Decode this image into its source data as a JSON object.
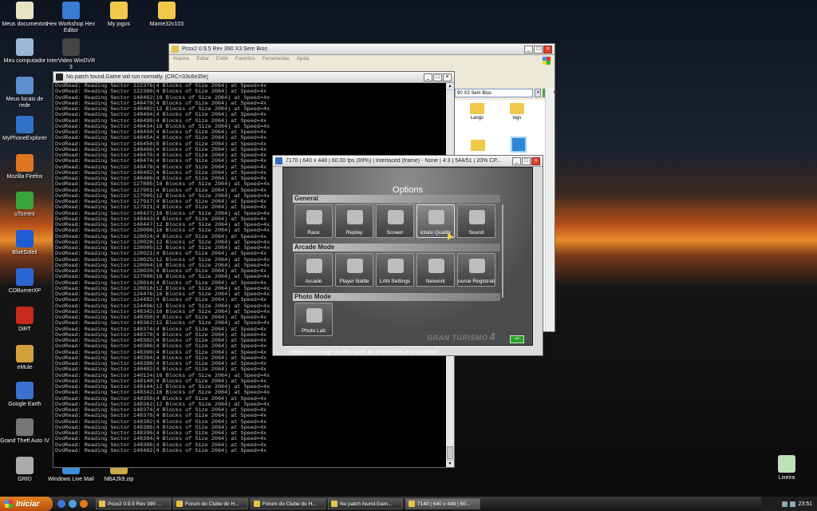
{
  "desktop": {
    "icons": [
      {
        "label": "Meus documentos",
        "color": "#e9e3c2"
      },
      {
        "label": "Hex Workshop Hex Editor",
        "color": "#3a7bd5"
      },
      {
        "label": "My jogos",
        "color": "#f0c94a"
      },
      {
        "label": "Mame32v103",
        "color": "#f0c94a"
      },
      {
        "label": "Meu computador",
        "color": "#9ab7d8"
      },
      {
        "label": "InterVideo WinDVR 3",
        "color": "#444444"
      },
      {
        "label": "Meus locais de rede",
        "color": "#5b8fd0"
      },
      {
        "label": "MyPhoneExplorer",
        "color": "#2f73c9"
      },
      {
        "label": "Mozilla Firefox",
        "color": "#e0751f"
      },
      {
        "label": "uTorrent",
        "color": "#3aa33a"
      },
      {
        "label": "BlueSoleil",
        "color": "#1f5bd4"
      },
      {
        "label": "CDBurnerXP",
        "color": "#2b67d2"
      },
      {
        "label": "DiRT",
        "color": "#c8281e"
      },
      {
        "label": "eMule",
        "color": "#d2a03a"
      },
      {
        "label": "Google Earth",
        "color": "#3b6fd0"
      },
      {
        "label": "Grand Theft Auto IV",
        "color": "#777777"
      },
      {
        "label": "GRID",
        "color": "#aaaaaa"
      },
      {
        "label": "Windows Live Mail",
        "color": "#3d8de0"
      },
      {
        "label": "NBA2k9.zip",
        "color": "#c9a94a"
      },
      {
        "label": "Lixeira",
        "color": "#bfe0b8"
      }
    ]
  },
  "explorer": {
    "title": "Pcsx2 0.9.5 Rev 390 X3 Sem Bios",
    "menu": [
      "Arquivo",
      "Editar",
      "Exibir",
      "Favoritos",
      "Ferramentas",
      "Ajuda"
    ],
    "address": "90 X3 Sem Bios",
    "go_label": "Ir",
    "folders": [
      "Langs",
      "logs"
    ]
  },
  "console": {
    "title": "No patch found.Game will run normally. [CRC=33c6e35e]",
    "lines": [
      "DvdRead: Reading Sector 122376(4 Blocks of Size 2064) at Speed=4x",
      "DvdRead: Reading Sector 122380(4 Blocks of Size 2064) at Speed=4x",
      "DvdRead: Reading Sector 148462(16 Blocks of Size 2064) at Speed=4x",
      "DvdRead: Reading Sector 148478(4 Blocks of Size 2064) at Speed=4x",
      "DvdRead: Reading Sector 148482(12 Blocks of Size 2064) at Speed=4x",
      "DvdRead: Reading Sector 148494(4 Blocks of Size 2064) at Speed=4x",
      "DvdRead: Reading Sector 148498(4 Blocks of Size 2064) at Speed=4x",
      "DvdRead: Reading Sector 148434(16 Blocks of Size 2064) at Speed=4x",
      "DvdRead: Reading Sector 148450(4 Blocks of Size 2064) at Speed=4x",
      "DvdRead: Reading Sector 148454(4 Blocks of Size 2064) at Speed=4x",
      "DvdRead: Reading Sector 148458(8 Blocks of Size 2064) at Speed=4x",
      "DvdRead: Reading Sector 148466(4 Blocks of Size 2064) at Speed=4x",
      "DvdRead: Reading Sector 148470(4 Blocks of Size 2064) at Speed=4x",
      "DvdRead: Reading Sector 148474(4 Blocks of Size 2064) at Speed=4x",
      "DvdRead: Reading Sector 148478(4 Blocks of Size 2064) at Speed=4x",
      "DvdRead: Reading Sector 148482(4 Blocks of Size 2064) at Speed=4x",
      "DvdRead: Reading Sector 148486(4 Blocks of Size 2064) at Speed=4x",
      "DvdRead: Reading Sector 127885(16 Blocks of Size 2064) at Speed=4x",
      "DvdRead: Reading Sector 127901(4 Blocks of Size 2064) at Speed=4x",
      "DvdRead: Reading Sector 127905(12 Blocks of Size 2064) at Speed=4x",
      "DvdRead: Reading Sector 127917(4 Blocks of Size 2064) at Speed=4x",
      "DvdRead: Reading Sector 127921(4 Blocks of Size 2064) at Speed=4x",
      "DvdRead: Reading Sector 148427(16 Blocks of Size 2064) at Speed=4x",
      "DvdRead: Reading Sector 148443(4 Blocks of Size 2064) at Speed=4x",
      "DvdRead: Reading Sector 148447(12 Blocks of Size 2064) at Speed=4x",
      "DvdRead: Reading Sector 128008(16 Blocks of Size 2064) at Speed=4x",
      "DvdRead: Reading Sector 128024(4 Blocks of Size 2064) at Speed=4x",
      "DvdRead: Reading Sector 128028(12 Blocks of Size 2064) at Speed=4x",
      "DvdRead: Reading Sector 128005(12 Blocks of Size 2064) at Speed=4x",
      "DvdRead: Reading Sector 128021(4 Blocks of Size 2064) at Speed=4x",
      "DvdRead: Reading Sector 128025(12 Blocks of Size 2064) at Speed=4x",
      "DvdRead: Reading Sector 128004(16 Blocks of Size 2064) at Speed=4x",
      "DvdRead: Reading Sector 128020(4 Blocks of Size 2064) at Speed=4x",
      "DvdRead: Reading Sector 127998(16 Blocks of Size 2064) at Speed=4x",
      "DvdRead: Reading Sector 128014(4 Blocks of Size 2064) at Speed=4x",
      "DvdRead: Reading Sector 128018(12 Blocks of Size 2064) at Speed=4x",
      "DvdRead: Reading Sector 124476(16 Blocks of Size 2064) at Speed=4x",
      "DvdRead: Reading Sector 124492(4 Blocks of Size 2064) at Speed=4x",
      "DvdRead: Reading Sector 124496(12 Blocks of Size 2064) at Speed=4x",
      "DvdRead: Reading Sector 148342(16 Blocks of Size 2064) at Speed=4x",
      "DvdRead: Reading Sector 148358(4 Blocks of Size 2064) at Speed=4x",
      "DvdRead: Reading Sector 148362(12 Blocks of Size 2064) at Speed=4x",
      "DvdRead: Reading Sector 148374(4 Blocks of Size 2064) at Speed=4x",
      "DvdRead: Reading Sector 148378(4 Blocks of Size 2064) at Speed=4x",
      "DvdRead: Reading Sector 148382(4 Blocks of Size 2064) at Speed=4x",
      "DvdRead: Reading Sector 148386(4 Blocks of Size 2064) at Speed=4x",
      "DvdRead: Reading Sector 148390(4 Blocks of Size 2064) at Speed=4x",
      "DvdRead: Reading Sector 148394(4 Blocks of Size 2064) at Speed=4x",
      "DvdRead: Reading Sector 148398(4 Blocks of Size 2064) at Speed=4x",
      "DvdRead: Reading Sector 148402(4 Blocks of Size 2064) at Speed=4x",
      "DvdRead: Reading Sector 140124(16 Blocks of Size 2064) at Speed=4x",
      "DvdRead: Reading Sector 148140(4 Blocks of Size 2064) at Speed=4x",
      "DvdRead: Reading Sector 148144(12 Blocks of Size 2064) at Speed=4x",
      "DvdRead: Reading Sector 148342(16 Blocks of Size 2064) at Speed=4x",
      "DvdRead: Reading Sector 148358(4 Blocks of Size 2064) at Speed=4x",
      "DvdRead: Reading Sector 148362(12 Blocks of Size 2064) at Speed=4x",
      "DvdRead: Reading Sector 148374(4 Blocks of Size 2064) at Speed=4x",
      "DvdRead: Reading Sector 148378(4 Blocks of Size 2064) at Speed=4x",
      "DvdRead: Reading Sector 148382(4 Blocks of Size 2064) at Speed=4x",
      "DvdRead: Reading Sector 148386(4 Blocks of Size 2064) at Speed=4x",
      "DvdRead: Reading Sector 148390(4 Blocks of Size 2064) at Speed=4x",
      "DvdRead: Reading Sector 148394(4 Blocks of Size 2064) at Speed=4x",
      "DvdRead: Reading Sector 148398(4 Blocks of Size 2064) at Speed=4x",
      "DvdRead: Reading Sector 148402(4 Blocks of Size 2064) at Speed=4x"
    ]
  },
  "game": {
    "title": "7170 | 640 x 448 | 60.00 fps (99%) | Interlaced (frame) - None | 4:3 | 544/51 | 20% CP...",
    "screen_title": "Options",
    "sections": [
      {
        "label": "General",
        "tiles": [
          "Race",
          "Replay",
          "Screen",
          "icture Quality",
          "Sound"
        ]
      },
      {
        "label": "Arcade Mode",
        "tiles": [
          "Arcade",
          "Player Battle",
          "LAN Settings",
          "Network",
          "ourse Registration"
        ]
      },
      {
        "label": "Photo Mode",
        "tiles": [
          "Photo Lab"
        ]
      }
    ],
    "logo_text": "GRAN TURISMO",
    "logo_number": "4",
    "help_text": "related to image quality such as brightness and contrast"
  },
  "taskbar": {
    "start_label": "Iniciar",
    "tasks": [
      {
        "label": "Pcsx2 0.9.5 Rev 390 ..."
      },
      {
        "label": "Fórum do Clube do H..."
      },
      {
        "label": "Fórum do Clube do H..."
      },
      {
        "label": "No patch found.Gam..."
      },
      {
        "label": "7140 | 640 x 448 | 60..."
      }
    ],
    "clock": "23:51"
  }
}
